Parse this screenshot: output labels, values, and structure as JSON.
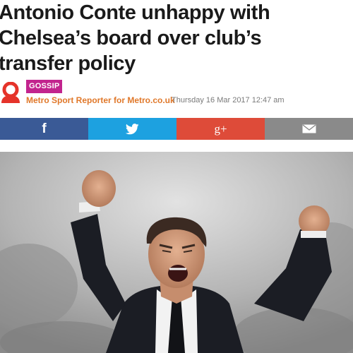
{
  "article": {
    "headline_lines": [
      "Antonio Conte unhappy with",
      "Chelsea’s board over club’s",
      "transfer policy"
    ],
    "category_tag": "GOSSIP",
    "author": "Metro Sport Reporter for Metro.co.uk",
    "timestamp": "Thursday 16 Mar 2017 12:47 am"
  },
  "share_bar": {
    "buttons": [
      {
        "network": "facebook",
        "icon": "facebook-icon",
        "glyph": "f",
        "color": "#3a5a96"
      },
      {
        "network": "twitter",
        "icon": "twitter-icon",
        "color": "#1da1e0"
      },
      {
        "network": "google-plus",
        "icon": "google-plus-icon",
        "glyph": "g+",
        "color": "#de4b39"
      },
      {
        "network": "email",
        "icon": "email-icon",
        "color": "#8a8a8a"
      }
    ]
  },
  "hero_image": {
    "subject": "Antonio Conte celebrating with both fists raised"
  },
  "colors": {
    "gossip_tag": "#c2248e",
    "author_link": "#e0782a",
    "avatar": "#e5332a"
  }
}
